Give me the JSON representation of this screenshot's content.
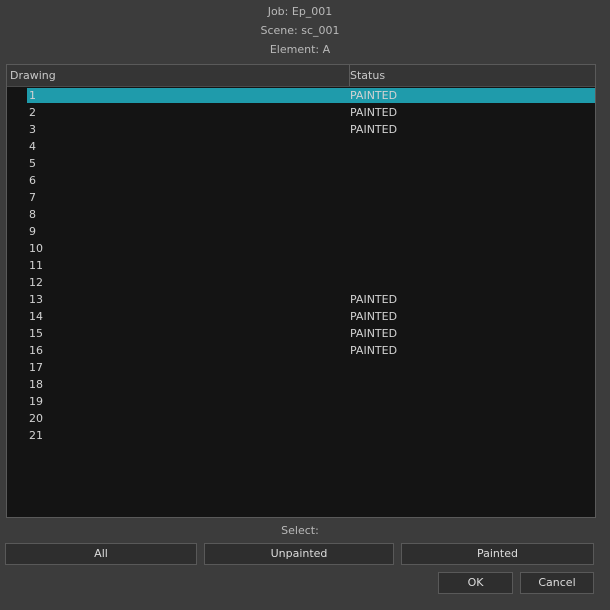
{
  "info": {
    "job": "Job: Ep_001",
    "scene": "Scene: sc_001",
    "element": "Element: A"
  },
  "table": {
    "columns": [
      "Drawing",
      "Status"
    ],
    "selected_row": "1",
    "rows": [
      {
        "drawing": "1",
        "status": "PAINTED"
      },
      {
        "drawing": "2",
        "status": "PAINTED"
      },
      {
        "drawing": "3",
        "status": "PAINTED"
      },
      {
        "drawing": "4",
        "status": ""
      },
      {
        "drawing": "5",
        "status": ""
      },
      {
        "drawing": "6",
        "status": ""
      },
      {
        "drawing": "7",
        "status": ""
      },
      {
        "drawing": "8",
        "status": ""
      },
      {
        "drawing": "9",
        "status": ""
      },
      {
        "drawing": "10",
        "status": ""
      },
      {
        "drawing": "11",
        "status": ""
      },
      {
        "drawing": "12",
        "status": ""
      },
      {
        "drawing": "13",
        "status": "PAINTED"
      },
      {
        "drawing": "14",
        "status": "PAINTED"
      },
      {
        "drawing": "15",
        "status": "PAINTED"
      },
      {
        "drawing": "16",
        "status": "PAINTED"
      },
      {
        "drawing": "17",
        "status": ""
      },
      {
        "drawing": "18",
        "status": ""
      },
      {
        "drawing": "19",
        "status": ""
      },
      {
        "drawing": "20",
        "status": ""
      },
      {
        "drawing": "21",
        "status": ""
      }
    ]
  },
  "select": {
    "label": "Select:",
    "all": "All",
    "unpainted": "Unpainted",
    "painted": "Painted"
  },
  "dialog": {
    "ok": "OK",
    "cancel": "Cancel"
  },
  "colors": {
    "selection": "#1f9bab",
    "background": "#3c3c3c",
    "table_bg": "#141414"
  }
}
